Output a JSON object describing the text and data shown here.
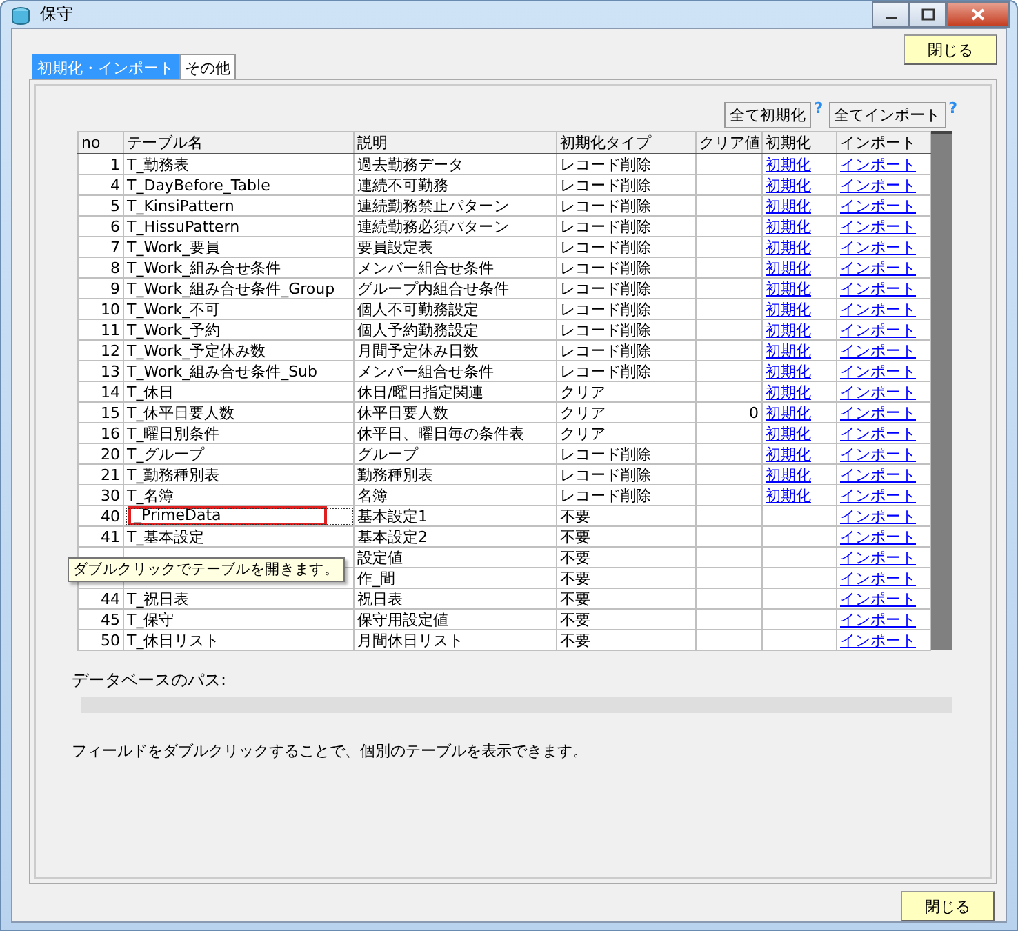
{
  "window": {
    "title": "保守"
  },
  "close_button_top": "閉じる",
  "tabs": [
    {
      "label": "初期化・インポート",
      "selected": true
    },
    {
      "label": "その他",
      "selected": false
    }
  ],
  "actions": [
    {
      "label": "全て初期化",
      "help": "?"
    },
    {
      "label": "全てインポート",
      "help": "?"
    }
  ],
  "table": {
    "columns": [
      "no",
      "テーブル名",
      "説明",
      "初期化タイプ",
      "クリア値",
      "初期化",
      "インポート"
    ],
    "rows": [
      {
        "no": "1",
        "name": "T_勤務表",
        "desc": "過去勤務データ",
        "type": "レコード削除",
        "init": "初期化",
        "import": "インポート",
        "focused": false
      },
      {
        "no": "4",
        "name": "T_DayBefore_Table",
        "desc": "連続不可勤務",
        "type": "レコード削除",
        "init": "初期化",
        "import": "インポート",
        "focused": false
      },
      {
        "no": "5",
        "name": "T_KinsiPattern",
        "desc": "連続勤務禁止パターン",
        "type": "レコード削除",
        "init": "初期化",
        "import": "インポート",
        "focused": false
      },
      {
        "no": "6",
        "name": "T_HissuPattern",
        "desc": "連続勤務必須パターン",
        "type": "レコード削除",
        "init": "初期化",
        "import": "インポート",
        "focused": false
      },
      {
        "no": "7",
        "name": "T_Work_要員",
        "desc": "要員設定表",
        "type": "レコード削除",
        "init": "初期化",
        "import": "インポート",
        "focused": false
      },
      {
        "no": "8",
        "name": "T_Work_組み合せ条件",
        "desc": "メンバー組合せ条件",
        "type": "レコード削除",
        "init": "初期化",
        "import": "インポート",
        "focused": false
      },
      {
        "no": "9",
        "name": "T_Work_組み合せ条件_Group",
        "desc": "グループ内組合せ条件",
        "type": "レコード削除",
        "init": "初期化",
        "import": "インポート",
        "focused": false
      },
      {
        "no": "10",
        "name": "T_Work_不可",
        "desc": "個人不可勤務設定",
        "type": "レコード削除",
        "init": "初期化",
        "import": "インポート",
        "focused": false
      },
      {
        "no": "11",
        "name": "T_Work_予約",
        "desc": "個人予約勤務設定",
        "type": "レコード削除",
        "init": "初期化",
        "import": "インポート",
        "focused": false
      },
      {
        "no": "12",
        "name": "T_Work_予定休み数",
        "desc": "月間予定休み日数",
        "type": "レコード削除",
        "init": "初期化",
        "import": "インポート",
        "focused": false
      },
      {
        "no": "13",
        "name": "T_Work_組み合せ条件_Sub",
        "desc": "メンバー組合せ条件",
        "type": "レコード削除",
        "init": "初期化",
        "import": "インポート",
        "focused": false
      },
      {
        "no": "14",
        "name": "T_休日",
        "desc": "休日/曜日指定関連",
        "type": "クリア",
        "init": "初期化",
        "import": "インポート",
        "focused": false
      },
      {
        "no": "15",
        "name": "T_休平日要人数",
        "desc": "休平日要人数",
        "type": "クリア",
        "clear": "0",
        "init": "初期化",
        "import": "インポート",
        "focused": false
      },
      {
        "no": "16",
        "name": "T_曜日別条件",
        "desc": "休平日、曜日毎の条件表",
        "type": "クリア",
        "init": "初期化",
        "import": "インポート",
        "focused": false
      },
      {
        "no": "20",
        "name": "T_グループ",
        "desc": "グループ",
        "type": "レコード削除",
        "init": "初期化",
        "import": "インポート",
        "focused": false
      },
      {
        "no": "21",
        "name": "T_勤務種別表",
        "desc": "勤務種別表",
        "type": "レコード削除",
        "init": "初期化",
        "import": "インポート",
        "focused": false
      },
      {
        "no": "30",
        "name": "T_名簿",
        "desc": "名簿",
        "type": "レコード削除",
        "init": "初期化",
        "import": "インポート",
        "focused": false
      },
      {
        "no": "40",
        "name": "_PrimeData",
        "desc": "基本設定1",
        "type": "不要",
        "import": "インポート",
        "focused": true
      },
      {
        "no": "41",
        "name": "T_基本設定",
        "desc": "基本設定2",
        "type": "不要",
        "import": "インポート",
        "focused": false
      },
      {
        "desc": "設定値",
        "type": "不要",
        "import": "インポート",
        "focused": false
      },
      {
        "desc": "作_間",
        "type": "不要",
        "import": "インポート",
        "focused": false
      },
      {
        "no": "44",
        "name": "T_祝日表",
        "desc": "祝日表",
        "type": "不要",
        "import": "インポート",
        "focused": false
      },
      {
        "no": "45",
        "name": "T_保守",
        "desc": "保守用設定値",
        "type": "不要",
        "import": "インポート",
        "focused": false
      },
      {
        "no": "50",
        "name": "T_休日リスト",
        "desc": "月間休日リスト",
        "type": "不要",
        "import": "インポート",
        "focused": false
      }
    ]
  },
  "tooltip": "ダブルクリックでテーブルを開きます。",
  "db_path": {
    "label": "データベースのパス:"
  },
  "note": "フィールドをダブルクリックすることで、個別のテーブルを表示できます。",
  "close_button_bottom": "閉じる"
}
